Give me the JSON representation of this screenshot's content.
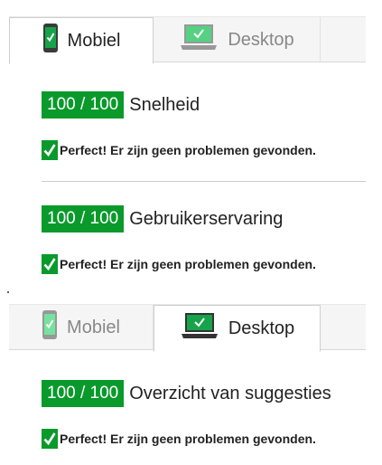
{
  "colors": {
    "score_green": "#099a2b",
    "check_green": "#0a9a2c",
    "tab_background": "#f5f5f5"
  },
  "mobile_panel": {
    "tabs": [
      {
        "label": "Mobiel",
        "icon": "phone-icon",
        "active": true
      },
      {
        "label": "Desktop",
        "icon": "laptop-icon",
        "active": false
      }
    ],
    "sections": [
      {
        "score": "100 / 100",
        "title": "Snelheid",
        "result_icon": "check-icon",
        "result": "Perfect! Er zijn geen problemen gevonden."
      },
      {
        "score": "100 / 100",
        "title": "Gebruikerservaring",
        "result_icon": "check-icon",
        "result": "Perfect! Er zijn geen problemen gevonden."
      }
    ]
  },
  "desktop_panel": {
    "tabs": [
      {
        "label": "Mobiel",
        "icon": "phone-icon",
        "active": false
      },
      {
        "label": "Desktop",
        "icon": "laptop-icon",
        "active": true
      }
    ],
    "sections": [
      {
        "score": "100 / 100",
        "title": "Overzicht van suggesties",
        "result_icon": "check-icon",
        "result": "Perfect! Er zijn geen problemen gevonden."
      }
    ]
  }
}
